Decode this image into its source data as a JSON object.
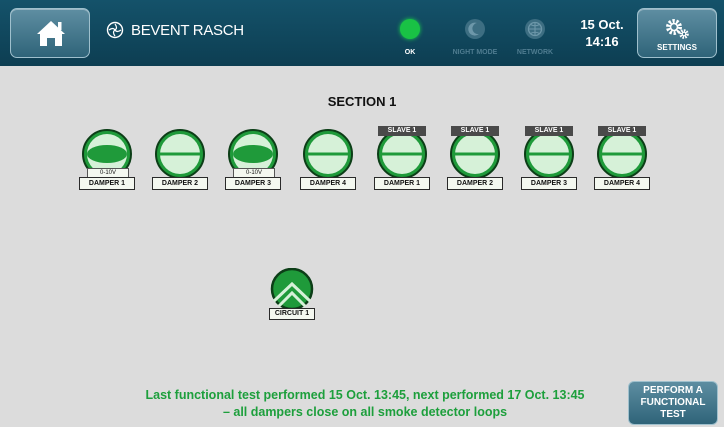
{
  "header": {
    "brand": "BEVENT RASCH",
    "status": [
      {
        "icon": "ok-status-icon",
        "label": "OK",
        "color": "#19c245",
        "label_color": "#ffffff"
      },
      {
        "icon": "moon-icon",
        "label": "NIGHT MODE",
        "label_color": "#4f7c90"
      },
      {
        "icon": "network-icon",
        "label": "NETWORK",
        "label_color": "#4f7c90"
      }
    ],
    "date": "15 Oct.",
    "time": "14:16",
    "settings_label": "SETTINGS"
  },
  "section": {
    "title": "SECTION 1"
  },
  "dampers": [
    {
      "label": "DAMPER 1",
      "sub": "0-10V",
      "state": "modulating"
    },
    {
      "label": "DAMPER 2",
      "state": "open"
    },
    {
      "label": "DAMPER 3",
      "sub": "0-10V",
      "state": "modulating"
    },
    {
      "label": "DAMPER 4",
      "state": "open"
    },
    {
      "label": "DAMPER 1",
      "slave": "SLAVE 1",
      "state": "open"
    },
    {
      "label": "DAMPER 2",
      "slave": "SLAVE 1",
      "state": "open"
    },
    {
      "label": "DAMPER 3",
      "slave": "SLAVE 1",
      "state": "open"
    },
    {
      "label": "DAMPER 4",
      "slave": "SLAVE 1",
      "state": "open"
    }
  ],
  "circuit": {
    "label": "CIRCUIT 1"
  },
  "footer": {
    "line1": "Last functional test performed 15 Oct. 13:45, next performed 17 Oct. 13:45",
    "line2": "– all dampers close on all smoke detector loops"
  },
  "functional_test_button": {
    "line1": "PERFORM A",
    "line2": "FUNCTIONAL",
    "line3": "TEST"
  },
  "colors": {
    "accent_green": "#1d9f3c",
    "header_bg": "#14526a",
    "damper_green": "#1f9a3a"
  }
}
